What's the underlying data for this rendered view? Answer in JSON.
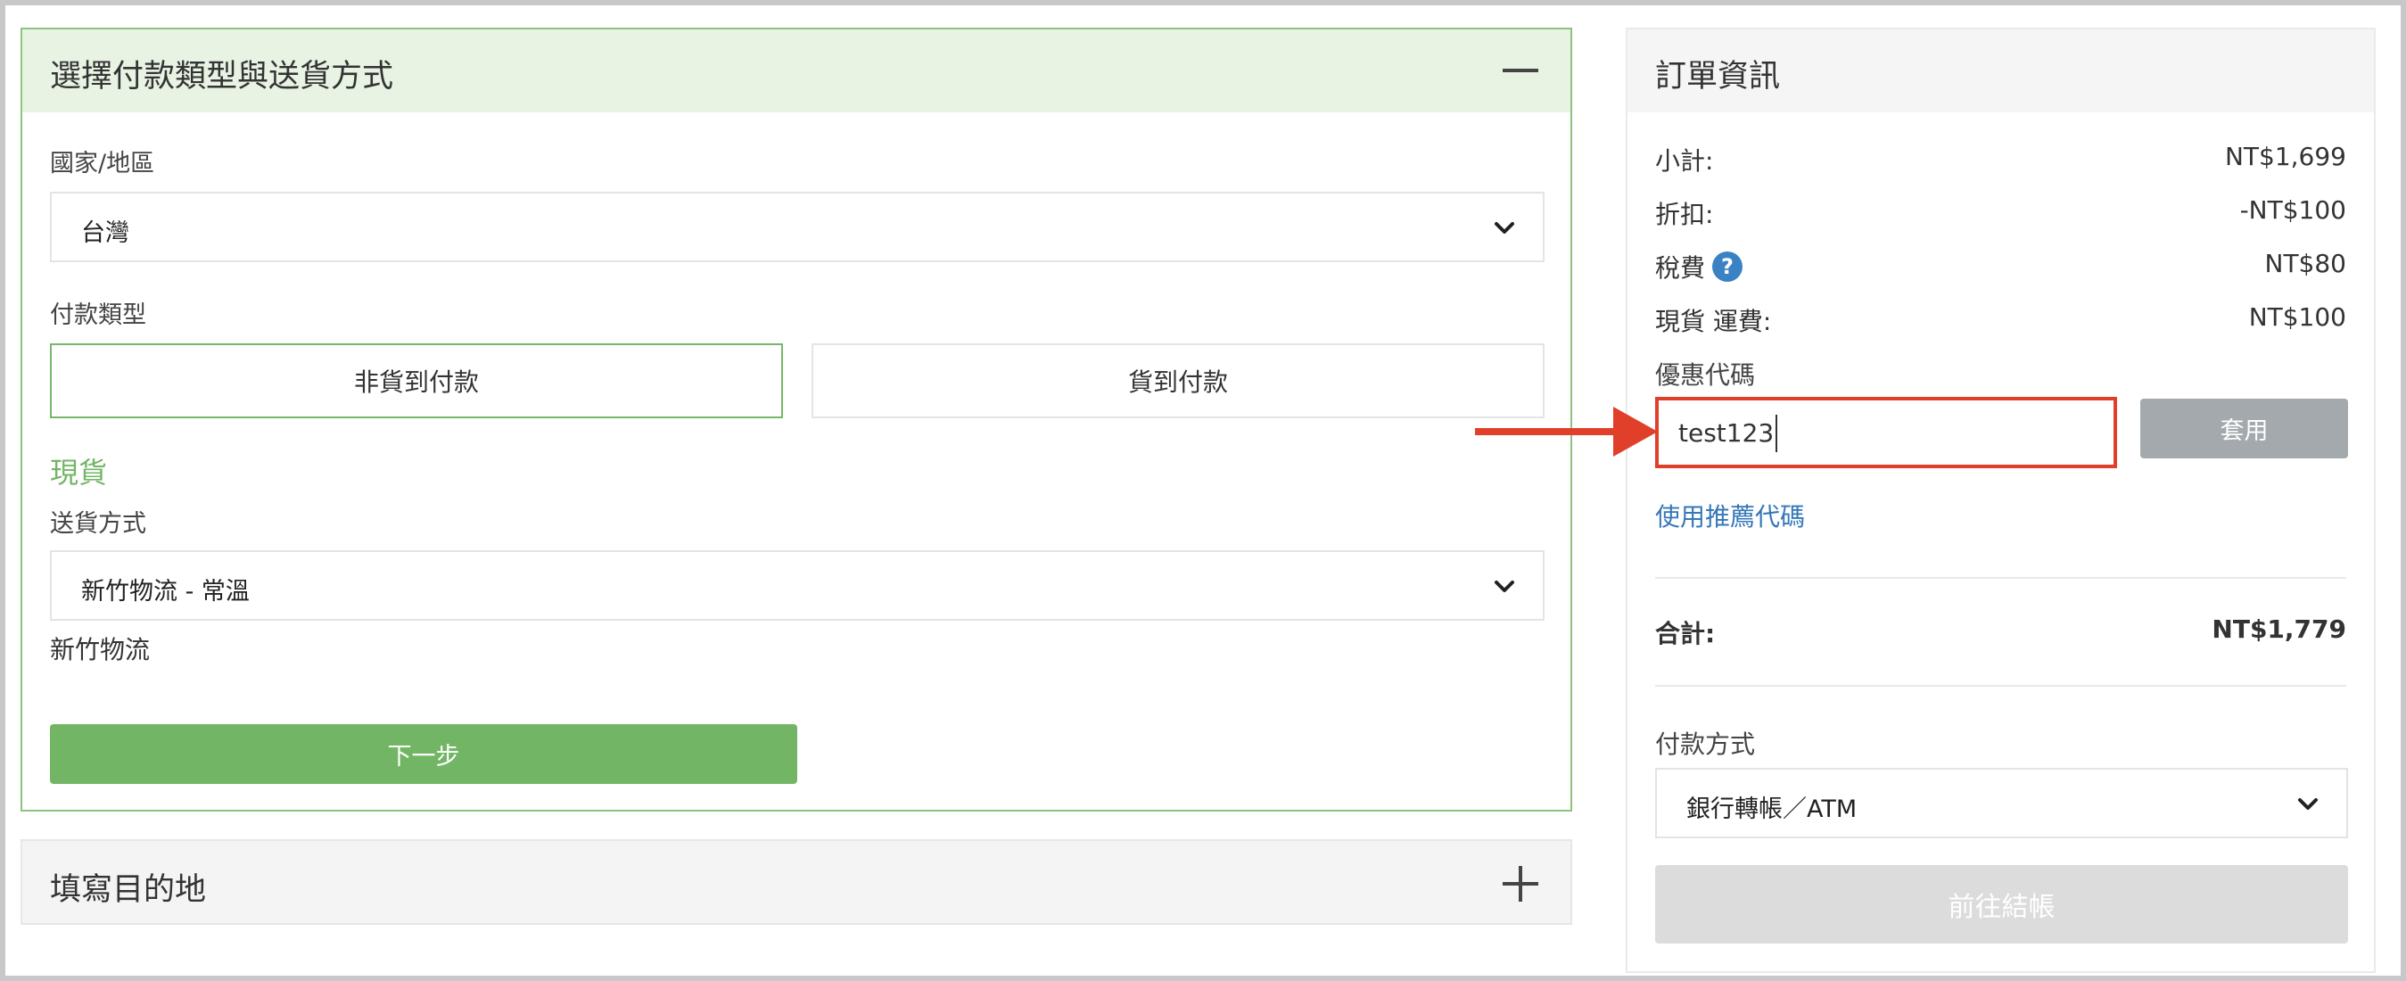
{
  "shipping_panel": {
    "title": "選擇付款類型與送貨方式",
    "country_label": "國家/地區",
    "country_value": "台灣",
    "payment_type_label": "付款類型",
    "payment_options": [
      "非貨到付款",
      "貨到付款"
    ],
    "selected_payment_option": "非貨到付款",
    "stock_label": "現貨",
    "delivery_method_label": "送貨方式",
    "delivery_method_value": "新竹物流 - 常溫",
    "carrier_name": "新竹物流",
    "next_button": "下一步"
  },
  "destination_panel": {
    "title": "填寫目的地"
  },
  "order_panel": {
    "title": "訂單資訊",
    "subtotal_label": "小計:",
    "subtotal_value": "NT$1,699",
    "discount_label": "折扣:",
    "discount_value": "-NT$100",
    "tax_label": "稅費",
    "tax_value": "NT$80",
    "shipping_label": "現貨 運費:",
    "shipping_value": "NT$100",
    "coupon_label": "優惠代碼",
    "coupon_value": "test123",
    "apply_button": "套用",
    "referral_link": "使用推薦代碼",
    "total_label": "合計:",
    "total_value": "NT$1,779",
    "payment_method_label": "付款方式",
    "payment_method_value": "銀行轉帳／ATM",
    "checkout_button": "前往結帳"
  },
  "colors": {
    "accent_green": "#72b665",
    "highlight_red": "#e0402a",
    "link_blue": "#3577b8"
  }
}
